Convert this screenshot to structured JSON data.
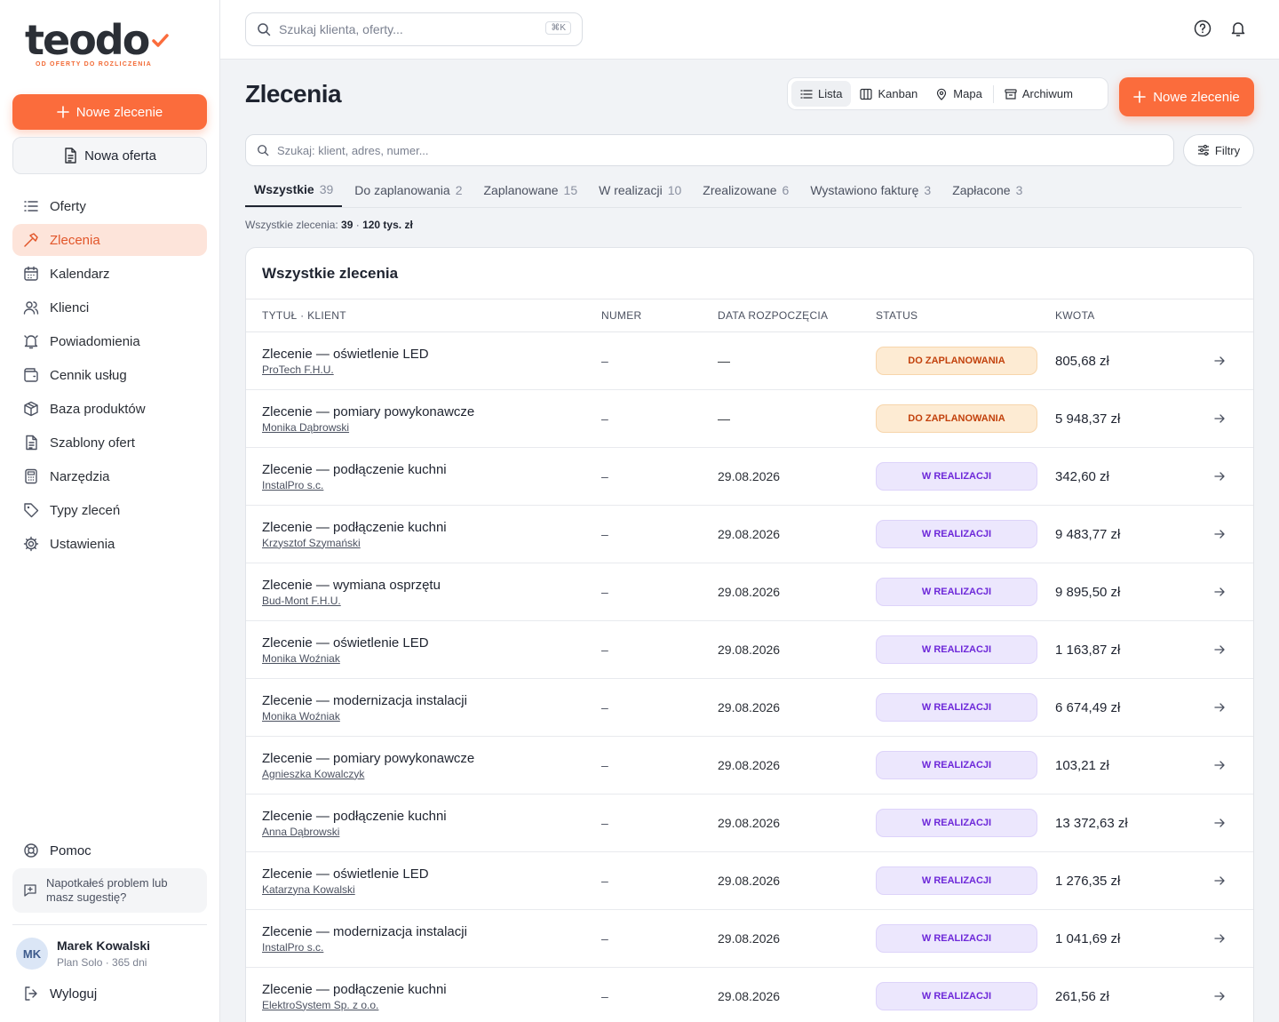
{
  "brand": {
    "name": "teodo",
    "tagline": "OD OFERTY DO ROZLICZENIA",
    "accent": "#fb6c3c"
  },
  "sidebar": {
    "new_order": "Nowe zlecenie",
    "new_offer": "Nowa oferta",
    "items": [
      {
        "label": "Oferty",
        "icon": "list-icon"
      },
      {
        "label": "Zlecenia",
        "icon": "hammer-icon",
        "active": true
      },
      {
        "label": "Kalendarz",
        "icon": "calendar-icon"
      },
      {
        "label": "Klienci",
        "icon": "users-icon"
      },
      {
        "label": "Powiadomienia",
        "icon": "bell-icon"
      },
      {
        "label": "Cennik usług",
        "icon": "wallet-icon"
      },
      {
        "label": "Baza produktów",
        "icon": "box-icon"
      },
      {
        "label": "Szablony ofert",
        "icon": "document-icon"
      },
      {
        "label": "Narzędzia",
        "icon": "calculator-icon"
      },
      {
        "label": "Typy zleceń",
        "icon": "tag-icon"
      },
      {
        "label": "Ustawienia",
        "icon": "gear-icon"
      }
    ],
    "help": "Pomoc",
    "feedback_line1": "Napotkałeś problem lub",
    "feedback_line2": "masz sugestię?",
    "user": {
      "initials": "MK",
      "name": "Marek Kowalski",
      "plan": "Plan Solo · 365 dni"
    },
    "logout": "Wyloguj"
  },
  "topbar": {
    "search_placeholder": "Szukaj klienta, oferty...",
    "shortcut": "⌘K"
  },
  "page": {
    "title": "Zlecenia",
    "views": [
      {
        "label": "Lista",
        "icon": "list-icon",
        "active": true
      },
      {
        "label": "Kanban",
        "icon": "columns-icon"
      },
      {
        "label": "Mapa",
        "icon": "pin-icon"
      },
      {
        "label": "Archiwum",
        "icon": "archive-icon"
      }
    ],
    "new_button": "Nowe zlecenie",
    "list_search_placeholder": "Szukaj: klient, adres, numer...",
    "filters": "Filtry",
    "tabs": [
      {
        "label": "Wszystkie",
        "count": "39",
        "active": true
      },
      {
        "label": "Do zaplanowania",
        "count": "2"
      },
      {
        "label": "Zaplanowane",
        "count": "15"
      },
      {
        "label": "W realizacji",
        "count": "10"
      },
      {
        "label": "Zrealizowane",
        "count": "6"
      },
      {
        "label": "Wystawiono fakturę",
        "count": "3"
      },
      {
        "label": "Zapłacone",
        "count": "3"
      }
    ],
    "summary_label": "Wszystkie zlecenia:",
    "summary_count": "39",
    "summary_sep": " · ",
    "summary_amount": "120 tys. zł"
  },
  "table": {
    "title": "Wszystkie zlecenia",
    "columns": [
      "TYTUŁ · KLIENT",
      "NUMER",
      "DATA ROZPOCZĘCIA",
      "STATUS",
      "KWOTA"
    ],
    "status_colors": {
      "plan_bg": "#fdebd3",
      "plan_fg": "#c2410c",
      "real_bg": "#ece7fd",
      "real_fg": "#6d28d9"
    },
    "rows": [
      {
        "title": "Zlecenie — oświetlenie LED",
        "client": "ProTech F.H.U.",
        "number": "–",
        "date": "—",
        "status": "DO ZAPLANOWANIA",
        "kind": "plan",
        "amount": "805,68 zł"
      },
      {
        "title": "Zlecenie — pomiary powykonawcze",
        "client": "Monika Dąbrowski",
        "number": "–",
        "date": "—",
        "status": "DO ZAPLANOWANIA",
        "kind": "plan",
        "amount": "5 948,37 zł"
      },
      {
        "title": "Zlecenie — podłączenie kuchni",
        "client": "InstalPro s.c.",
        "number": "–",
        "date": "29.08.2026",
        "status": "W REALIZACJI",
        "kind": "real",
        "amount": "342,60 zł"
      },
      {
        "title": "Zlecenie — podłączenie kuchni",
        "client": "Krzysztof Szymański",
        "number": "–",
        "date": "29.08.2026",
        "status": "W REALIZACJI",
        "kind": "real",
        "amount": "9 483,77 zł"
      },
      {
        "title": "Zlecenie — wymiana osprzętu",
        "client": "Bud-Mont F.H.U.",
        "number": "–",
        "date": "29.08.2026",
        "status": "W REALIZACJI",
        "kind": "real",
        "amount": "9 895,50 zł"
      },
      {
        "title": "Zlecenie — oświetlenie LED",
        "client": "Monika Woźniak",
        "number": "–",
        "date": "29.08.2026",
        "status": "W REALIZACJI",
        "kind": "real",
        "amount": "1 163,87 zł"
      },
      {
        "title": "Zlecenie — modernizacja instalacji",
        "client": "Monika Woźniak",
        "number": "–",
        "date": "29.08.2026",
        "status": "W REALIZACJI",
        "kind": "real",
        "amount": "6 674,49 zł"
      },
      {
        "title": "Zlecenie — pomiary powykonawcze",
        "client": "Agnieszka Kowalczyk",
        "number": "–",
        "date": "29.08.2026",
        "status": "W REALIZACJI",
        "kind": "real",
        "amount": "103,21 zł"
      },
      {
        "title": "Zlecenie — podłączenie kuchni",
        "client": "Anna Dąbrowski",
        "number": "–",
        "date": "29.08.2026",
        "status": "W REALIZACJI",
        "kind": "real",
        "amount": "13 372,63 zł"
      },
      {
        "title": "Zlecenie — oświetlenie LED",
        "client": "Katarzyna Kowalski",
        "number": "–",
        "date": "29.08.2026",
        "status": "W REALIZACJI",
        "kind": "real",
        "amount": "1 276,35 zł"
      },
      {
        "title": "Zlecenie — modernizacja instalacji",
        "client": "InstalPro s.c.",
        "number": "–",
        "date": "29.08.2026",
        "status": "W REALIZACJI",
        "kind": "real",
        "amount": "1 041,69 zł"
      },
      {
        "title": "Zlecenie — podłączenie kuchni",
        "client": "ElektroSystem Sp. z o.o.",
        "number": "–",
        "date": "29.08.2026",
        "status": "W REALIZACJI",
        "kind": "real",
        "amount": "261,56 zł"
      }
    ]
  }
}
